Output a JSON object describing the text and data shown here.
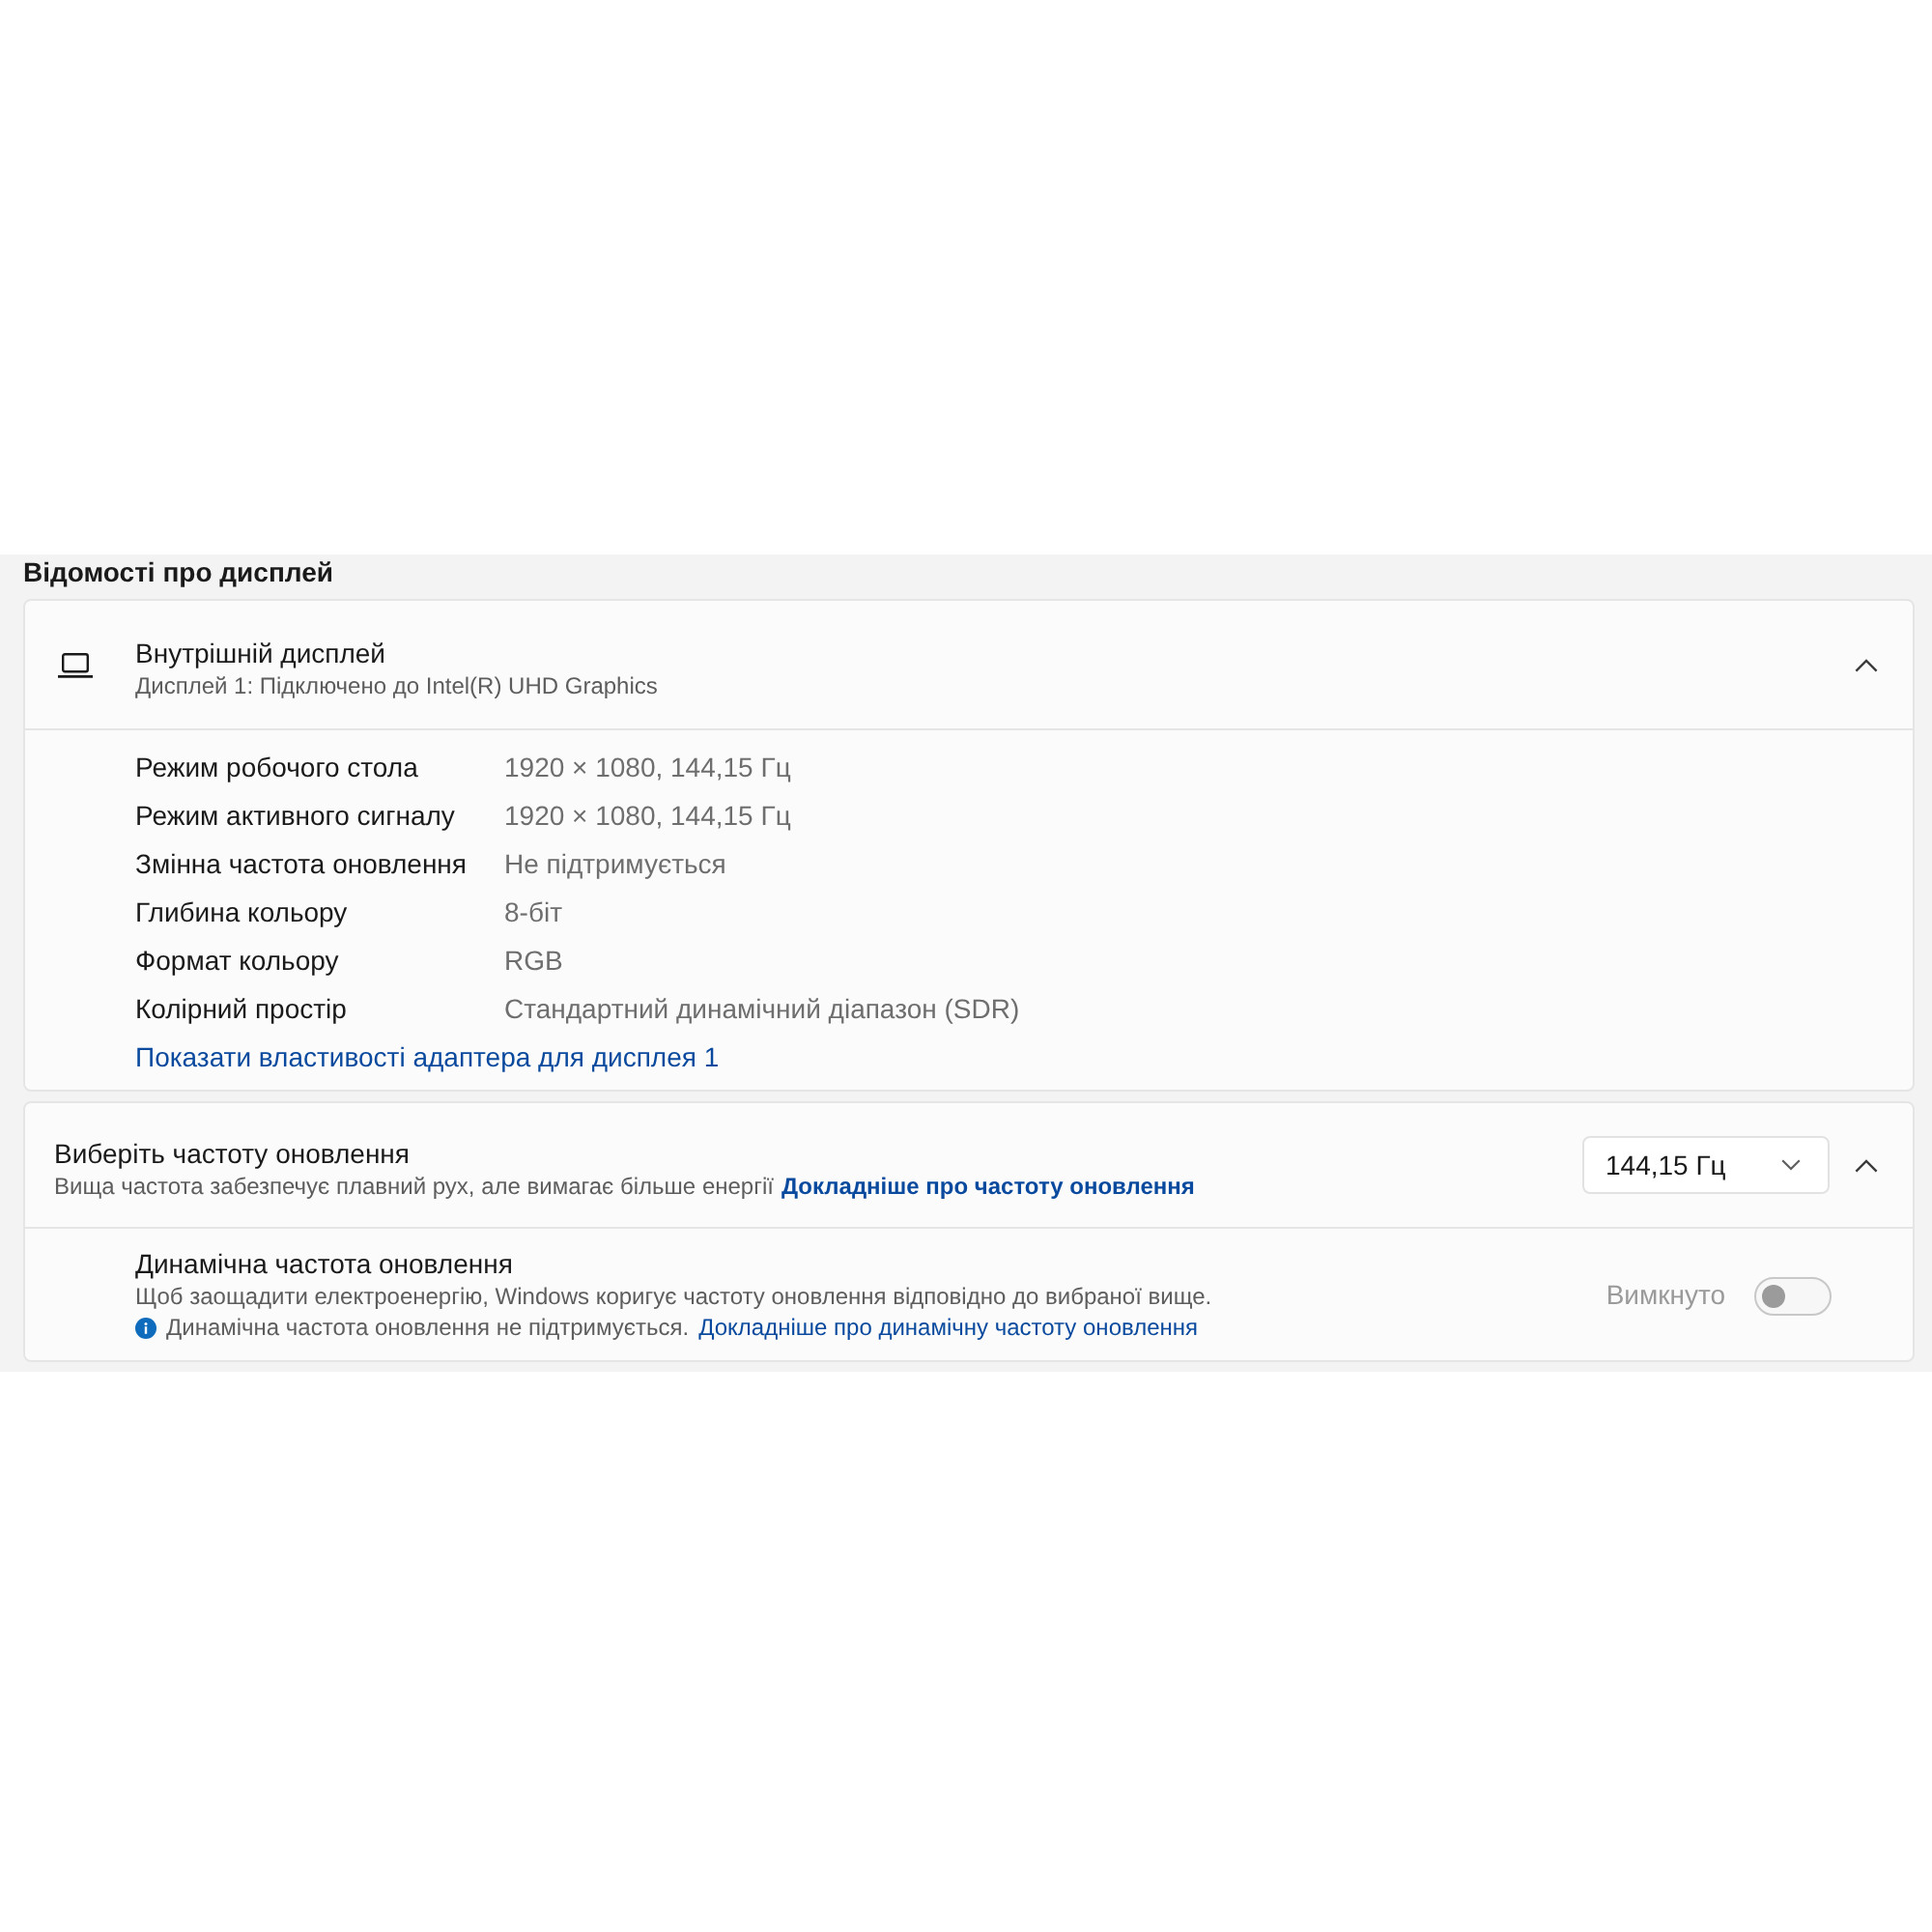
{
  "section_title": "Відомості про дисплей",
  "display_card": {
    "title": "Внутрішній дисплей",
    "subtitle": "Дисплей 1: Підключено до Intel(R) UHD Graphics",
    "expanded": true,
    "properties": [
      {
        "label": "Режим робочого стола",
        "value": "1920 × 1080, 144,15 Гц"
      },
      {
        "label": "Режим активного сигналу",
        "value": "1920 × 1080, 144,15 Гц"
      },
      {
        "label": "Змінна частота оновлення",
        "value": "Не підтримується"
      },
      {
        "label": "Глибина кольору",
        "value": "8-біт"
      },
      {
        "label": "Формат кольору",
        "value": "RGB"
      },
      {
        "label": "Колірний простір",
        "value": "Стандартний динамічний діапазон (SDR)"
      }
    ],
    "link": "Показати властивості адаптера для дисплея 1"
  },
  "refresh_card": {
    "title": "Виберіть частоту оновлення",
    "subtitle": "Вища частота забезпечує плавний рух, але вимагає більше енергії",
    "link": "Докладніше про частоту оновлення",
    "dropdown": {
      "value": "144,15 Гц"
    },
    "expanded": true,
    "dynamic": {
      "title": "Динамічна частота оновлення",
      "description": "Щоб заощадити електроенергію, Windows коригує частоту оновлення відповідно до вибраної вище.",
      "info": "Динамічна частота оновлення не підтримується.",
      "link": "Докладніше про динамічну частоту оновлення",
      "toggle": {
        "label": "Вимкнуто",
        "on": false,
        "disabled": true
      }
    }
  }
}
